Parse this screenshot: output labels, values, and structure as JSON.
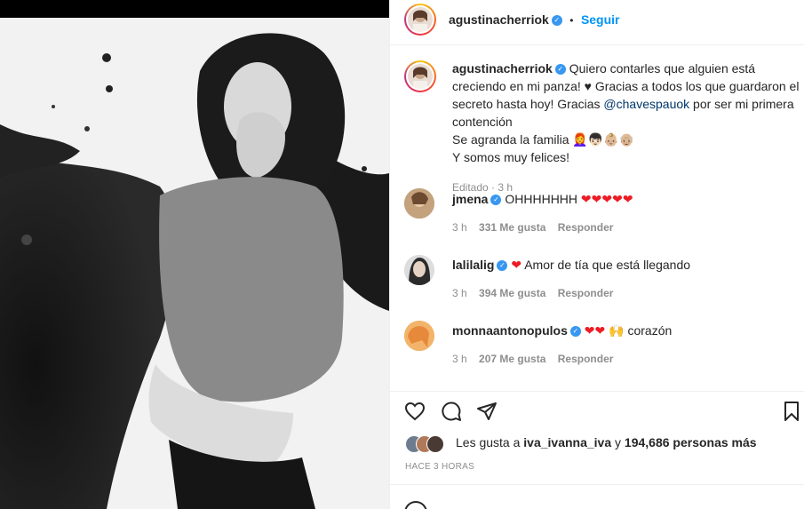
{
  "post": {
    "author": "agustinacherriok",
    "separator": "•",
    "follow_label": "Seguir",
    "more_label": "···",
    "caption": {
      "author": "agustinacherriok",
      "text_1": "Quiero contarles que alguien está creciendo en mi panza! ♥ Gracias a todos los que guardaron el secreto hasta hoy! Gracias",
      "mention": "@chavespauok",
      "text_2": "por ser mi primera contención",
      "line_3": "Se agranda la familia 👩‍🦰👦🏻👶🏼👴🏼",
      "line_4": "Y somos muy felices!",
      "edited": "Editado · 3 h"
    },
    "comments": [
      {
        "user": "jmena",
        "text": "OHHHHHHH",
        "hearts": "❤❤❤❤❤",
        "time": "3 h",
        "likes": "331 Me gusta",
        "reply": "Responder"
      },
      {
        "user": "lalilalig",
        "text": "Amor de tía que está llegando",
        "hearts": "❤",
        "time": "3 h",
        "likes": "394 Me gusta",
        "reply": "Responder"
      },
      {
        "user": "monnaantonopulos",
        "text": "corazón",
        "hearts": "❤❤",
        "emoji": "🙌",
        "time": "3 h",
        "likes": "207 Me gusta",
        "reply": "Responder"
      }
    ],
    "likes": {
      "prefix": "Les gusta a",
      "user": "iva_ivanna_iva",
      "conj": "y",
      "count": "194,686 personas más"
    },
    "time_ago": "HACE 3 HORAS"
  },
  "colors": {
    "accent": "#0095f6",
    "heart": "#ed1c24",
    "verified": "#3897f0"
  }
}
